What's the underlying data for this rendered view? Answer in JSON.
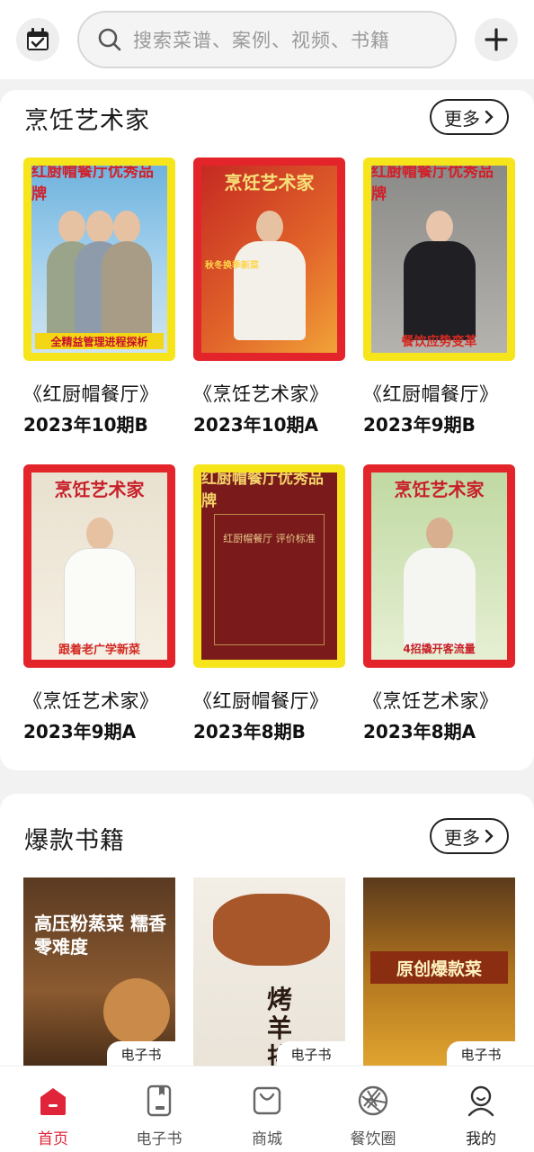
{
  "header": {
    "search_placeholder": "搜索菜谱、案例、视频、书籍"
  },
  "section_magazines": {
    "title": "烹饪艺术家",
    "more_label": "更多",
    "items": [
      {
        "title": "《红厨帽餐厅》",
        "issue": "2023年10期B",
        "masthead": "红厨帽餐厅优秀品牌",
        "tagline": "全精益管理进程探析"
      },
      {
        "title": "《烹饪艺术家》",
        "issue": "2023年10期A",
        "masthead": "烹饪艺术家",
        "tagline": "秋冬换季新菜"
      },
      {
        "title": "《红厨帽餐厅》",
        "issue": "2023年9期B",
        "masthead": "红厨帽餐厅优秀品牌",
        "tagline": "餐饮应势变革"
      },
      {
        "title": "《烹饪艺术家》",
        "issue": "2023年9期A",
        "masthead": "烹饪艺术家",
        "tagline": "跟着老广学新菜"
      },
      {
        "title": "《红厨帽餐厅》",
        "issue": "2023年8期B",
        "masthead": "红厨帽餐厅优秀品牌",
        "tagline": "红厨帽餐厅 评价标准"
      },
      {
        "title": "《烹饪艺术家》",
        "issue": "2023年8期A",
        "masthead": "烹饪艺术家",
        "tagline": "4招撬开客流量"
      }
    ]
  },
  "section_books": {
    "title": "爆款书籍",
    "more_label": "更多",
    "items": [
      {
        "cover_title": "高压粉蒸菜 糯香零难度",
        "badge": "电子书"
      },
      {
        "cover_title": "烤羊排",
        "badge": "电子书"
      },
      {
        "cover_title": "原创爆款菜",
        "badge": "电子书"
      }
    ]
  },
  "nav": {
    "items": [
      {
        "label": "首页",
        "icon": "home-icon",
        "active": true
      },
      {
        "label": "电子书",
        "icon": "ebook-icon"
      },
      {
        "label": "商城",
        "icon": "shopping-bag-icon"
      },
      {
        "label": "餐饮圈",
        "icon": "camera-aperture-icon"
      },
      {
        "label": "我的",
        "icon": "user-icon"
      }
    ]
  },
  "colors": {
    "accent": "#e0243a",
    "yellow_frame": "#f7e51c",
    "red_frame": "#e3242b"
  }
}
